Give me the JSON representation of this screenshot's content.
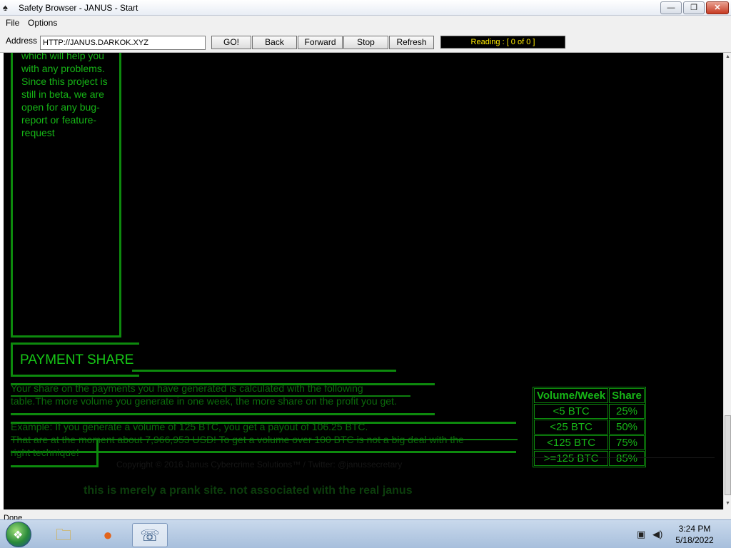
{
  "window": {
    "title": "Safety Browser - JANUS - Start",
    "app_icon": "spade-icon",
    "controls": {
      "minimize": "—",
      "maximize": "❐",
      "close": "✕"
    }
  },
  "menu": {
    "file": "File",
    "options": "Options"
  },
  "toolbar": {
    "address_label": "Address :",
    "address_value": "HTTP://JANUS.DARKOK.XYZ",
    "go": "GO!",
    "back": "Back",
    "forward": "Forward",
    "stop": "Stop",
    "refresh": "Refresh",
    "reading": "Reading : [ 0  of  0 ]"
  },
  "page": {
    "side_text": "which will help you with any problems. Since this project is still in beta, we are open for any bug-report or feature-request",
    "payment_title": "PAYMENT SHARE",
    "para1_line1": "Your share on the payments you have generated is calculated with the following",
    "para1_line2": "table.The more volume you generate in one week, the more share on the profit you get.",
    "para2_line1": "Example: If you generate a volume of 125 BTC, you get a payout of 106.25 BTC.",
    "para2_line2": "That are at the moment about 7,966,953 USD! To get a volume over 100 BTC is not a big deal with the",
    "para2_line3": "right technique!",
    "table": {
      "headers": [
        "Volume/Week",
        "Share"
      ],
      "rows": [
        [
          "<5 BTC",
          "25%"
        ],
        [
          "<25 BTC",
          "50%"
        ],
        [
          "<125 BTC",
          "75%"
        ],
        [
          ">=125 BTC",
          "85%"
        ]
      ]
    },
    "copyright": "Copyright © 2016 Janus Cybercrime Solutions™ / Twitter: @janussecretary",
    "prank_notice": "this is merely a prank site. not associated with the real janus"
  },
  "status": {
    "text": "Done"
  },
  "taskbar": {
    "start": "windows-start-icon",
    "apps": [
      "explorer-folder-icon",
      "firefox-icon",
      "safety-browser-icon"
    ],
    "clock_time": "3:24 PM",
    "clock_date": "5/18/2022"
  },
  "colors": {
    "page_bg": "#000000",
    "accent_green": "#16b516",
    "border_green": "#0d8a0d",
    "reading_text": "#ffea00"
  }
}
